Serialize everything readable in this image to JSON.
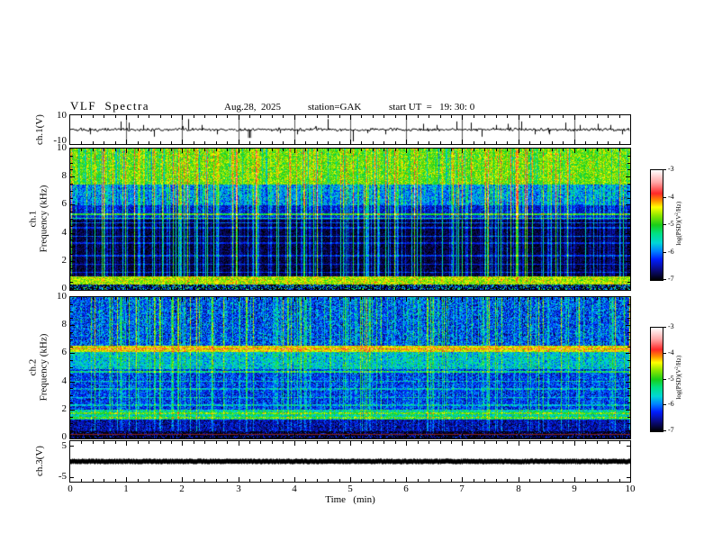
{
  "header": {
    "title": "VLF  Spectra",
    "date": "Aug.28,  2025",
    "station": "station=GAK",
    "start_ut": "start UT  =   19: 30: 0"
  },
  "x_axis": {
    "label": "Time   (min)",
    "min": 0,
    "max": 10,
    "major_step": 1,
    "minor_step": 0.2,
    "tick_labels": [
      "0",
      "1",
      "2",
      "3",
      "4",
      "5",
      "6",
      "7",
      "8",
      "9",
      "10"
    ]
  },
  "panels": [
    {
      "id": "ch1-waveform",
      "ylabel": "ch.1(V)",
      "ytick_labels": [
        "10",
        "-10"
      ]
    },
    {
      "id": "ch1-spectrogram",
      "ylabel_lines": [
        "ch.1",
        "Frequency  (kHz)"
      ],
      "ytick_labels": [
        "10",
        "8",
        "6",
        "4",
        "2",
        "0"
      ]
    },
    {
      "id": "ch2-spectrogram",
      "ylabel_lines": [
        "ch.2",
        "Frequency  (kHz)"
      ],
      "ytick_labels": [
        "10",
        "8",
        "6",
        "4",
        "2",
        "0"
      ]
    },
    {
      "id": "ch3-waveform",
      "ylabel": "ch.3(V)",
      "ytick_labels": [
        "5",
        "-5"
      ]
    }
  ],
  "colorbars": [
    {
      "tick_labels": [
        "-3",
        "-4",
        "-5",
        "-6",
        "-7"
      ],
      "label_prefix": "log(PSD)(V",
      "label_sup": "2",
      "label_suffix": "/Hz)"
    },
    {
      "tick_labels": [
        "-3",
        "-4",
        "-5",
        "-6",
        "-7"
      ],
      "label_prefix": "log(PSD)(V",
      "label_sup": "2",
      "label_suffix": "/Hz)"
    }
  ],
  "colors": {
    "frame": "#000000",
    "grid": "#555555",
    "trace": "#000000",
    "dropout_gray": "#999999",
    "background": "#ffffff"
  },
  "chart_data": [
    {
      "type": "line",
      "panel": "ch.1(V)",
      "x_range_min": [
        0,
        10
      ],
      "y_range_V": [
        -12.3,
        12.3
      ],
      "y_tick_values": [
        10,
        -10
      ],
      "baseline_V": 0,
      "noise_V": 1.6,
      "grid_lines_min": [
        1,
        2,
        3,
        4,
        5,
        6,
        7,
        8,
        9
      ],
      "spikes_min_V": [
        [
          0.35,
          -4
        ],
        [
          0.9,
          7
        ],
        [
          1.05,
          6
        ],
        [
          1.3,
          4
        ],
        [
          1.5,
          -6
        ],
        [
          2.1,
          9
        ],
        [
          2.35,
          4
        ],
        [
          2.62,
          -4
        ],
        [
          3.2,
          -7
        ],
        [
          3.75,
          -3
        ],
        [
          4.05,
          -4
        ],
        [
          4.6,
          9
        ],
        [
          5.05,
          -10
        ],
        [
          5.3,
          -3
        ],
        [
          5.62,
          -4
        ],
        [
          6.3,
          5
        ],
        [
          6.55,
          4
        ],
        [
          6.9,
          7
        ],
        [
          7.15,
          6
        ],
        [
          7.35,
          -6
        ],
        [
          7.6,
          4
        ],
        [
          7.82,
          5
        ],
        [
          8.05,
          7
        ],
        [
          8.3,
          -4
        ],
        [
          8.55,
          -4
        ],
        [
          8.85,
          6
        ],
        [
          9.1,
          4
        ],
        [
          9.42,
          5
        ],
        [
          9.65,
          4
        ],
        [
          9.85,
          -4
        ]
      ],
      "dropout": {
        "x_min": 3.2,
        "width_min": 0.07,
        "depth_V": -7
      }
    },
    {
      "type": "heatmap",
      "panel": "ch.1 Frequency (kHz)",
      "x_range_min": [
        0,
        10
      ],
      "y_range_kHz": [
        0,
        10
      ],
      "z_label": "log(PSD)(V^2/Hz)",
      "z_range": [
        -7,
        -3
      ],
      "bands": [
        {
          "f_lo": 7.5,
          "f_hi": 10.0,
          "base": -4.8,
          "noise": 0.45,
          "streak": 0.5,
          "dark": 0.55
        },
        {
          "f_lo": 6.0,
          "f_hi": 7.5,
          "base": -5.9,
          "noise": 0.5,
          "streak": 1.2,
          "dark": 0.2
        },
        {
          "f_lo": 5.0,
          "f_hi": 6.0,
          "base": -6.4,
          "noise": 0.35,
          "streak": 1.1,
          "dark": 0
        },
        {
          "f_lo": 0.9,
          "f_hi": 5.0,
          "base": -6.85,
          "noise": 0.25,
          "streak": 1.05,
          "dark": 0
        },
        {
          "f_lo": 0.35,
          "f_hi": 0.9,
          "base": -4.6,
          "noise": 0.45,
          "streak": 0.15,
          "dark": 0
        },
        {
          "f_lo": 0.0,
          "f_hi": 0.35,
          "base": -6.6,
          "noise": 1.5,
          "streak": 0.1,
          "dark": 0
        }
      ],
      "h_lines": [
        {
          "f": 5.35,
          "boost": 1.3
        },
        {
          "f": 5.05,
          "boost": 0.9
        },
        {
          "f": 4.75,
          "boost": 0.7
        },
        {
          "f": 4.4,
          "boost": 0.55
        },
        {
          "f": 3.8,
          "boost": 0.65
        },
        {
          "f": 3.3,
          "boost": 0.45
        },
        {
          "f": 2.4,
          "boost": 0.55
        },
        {
          "f": 1.8,
          "boost": 0.45
        },
        {
          "f": 1.2,
          "boost": 0.55
        }
      ]
    },
    {
      "type": "heatmap",
      "panel": "ch.2 Frequency (kHz)",
      "x_range_min": [
        0,
        10
      ],
      "y_range_kHz": [
        0,
        10
      ],
      "z_label": "log(PSD)(V^2/Hz)",
      "z_range": [
        -7,
        -3
      ],
      "bands": [
        {
          "f_lo": 6.6,
          "f_hi": 10.0,
          "base": -6.15,
          "noise": 0.55,
          "streak": 0.85,
          "dark": 0.15
        },
        {
          "f_lo": 6.1,
          "f_hi": 6.6,
          "base": -4.45,
          "noise": 0.4,
          "streak": 0.25,
          "dark": 0
        },
        {
          "f_lo": 4.9,
          "f_hi": 6.1,
          "base": -5.7,
          "noise": 0.5,
          "streak": 0.55,
          "dark": 0
        },
        {
          "f_lo": 2.0,
          "f_hi": 4.9,
          "base": -6.25,
          "noise": 0.45,
          "streak": 0.55,
          "dark": 0
        },
        {
          "f_lo": 1.3,
          "f_hi": 2.0,
          "base": -5.5,
          "noise": 0.5,
          "streak": 0.4,
          "dark": 0
        },
        {
          "f_lo": 0.45,
          "f_hi": 1.3,
          "base": -6.55,
          "noise": 0.4,
          "streak": 0.35,
          "dark": 0
        },
        {
          "f_lo": 0.0,
          "f_hi": 0.45,
          "base": -6.95,
          "noise": 0.7,
          "streak": 0.1,
          "dark": 0
        }
      ],
      "h_lines": [
        {
          "f": 6.35,
          "boost": 0.5
        },
        {
          "f": 4.7,
          "boost": 0.9
        },
        {
          "f": 4.05,
          "boost": 0.5
        },
        {
          "f": 3.5,
          "boost": 0.5
        },
        {
          "f": 2.9,
          "boost": 0.45
        },
        {
          "f": 2.35,
          "boost": 0.5
        },
        {
          "f": 1.75,
          "boost": 0.6
        },
        {
          "f": 1.45,
          "boost": 0.55
        },
        {
          "f": 0.25,
          "color": "#8a2020"
        }
      ]
    },
    {
      "type": "line",
      "panel": "ch.3(V)",
      "x_range_min": [
        0,
        10
      ],
      "y_range_V": [
        -6.5,
        6.5
      ],
      "y_tick_values": [
        5,
        -5
      ],
      "baseline_V": 0,
      "trace_thickness_V": 1,
      "description": "flat saturated trace at 0 V"
    }
  ],
  "colormap": {
    "z_range": [
      -7,
      -3
    ],
    "stops": [
      [
        -7.0,
        [
          0,
          0,
          0
        ]
      ],
      [
        -6.65,
        [
          10,
          10,
          120
        ]
      ],
      [
        -6.25,
        [
          0,
          30,
          255
        ]
      ],
      [
        -5.95,
        [
          0,
          130,
          255
        ]
      ],
      [
        -5.65,
        [
          0,
          215,
          215
        ]
      ],
      [
        -5.3,
        [
          0,
          225,
          130
        ]
      ],
      [
        -5.0,
        [
          25,
          205,
          25
        ]
      ],
      [
        -4.65,
        [
          140,
          230,
          0
        ]
      ],
      [
        -4.35,
        [
          255,
          255,
          0
        ]
      ],
      [
        -4.1,
        [
          255,
          140,
          0
        ]
      ],
      [
        -3.85,
        [
          255,
          40,
          40
        ]
      ],
      [
        -3.45,
        [
          255,
          165,
          165
        ]
      ],
      [
        -3.0,
        [
          255,
          255,
          255
        ]
      ]
    ]
  }
}
